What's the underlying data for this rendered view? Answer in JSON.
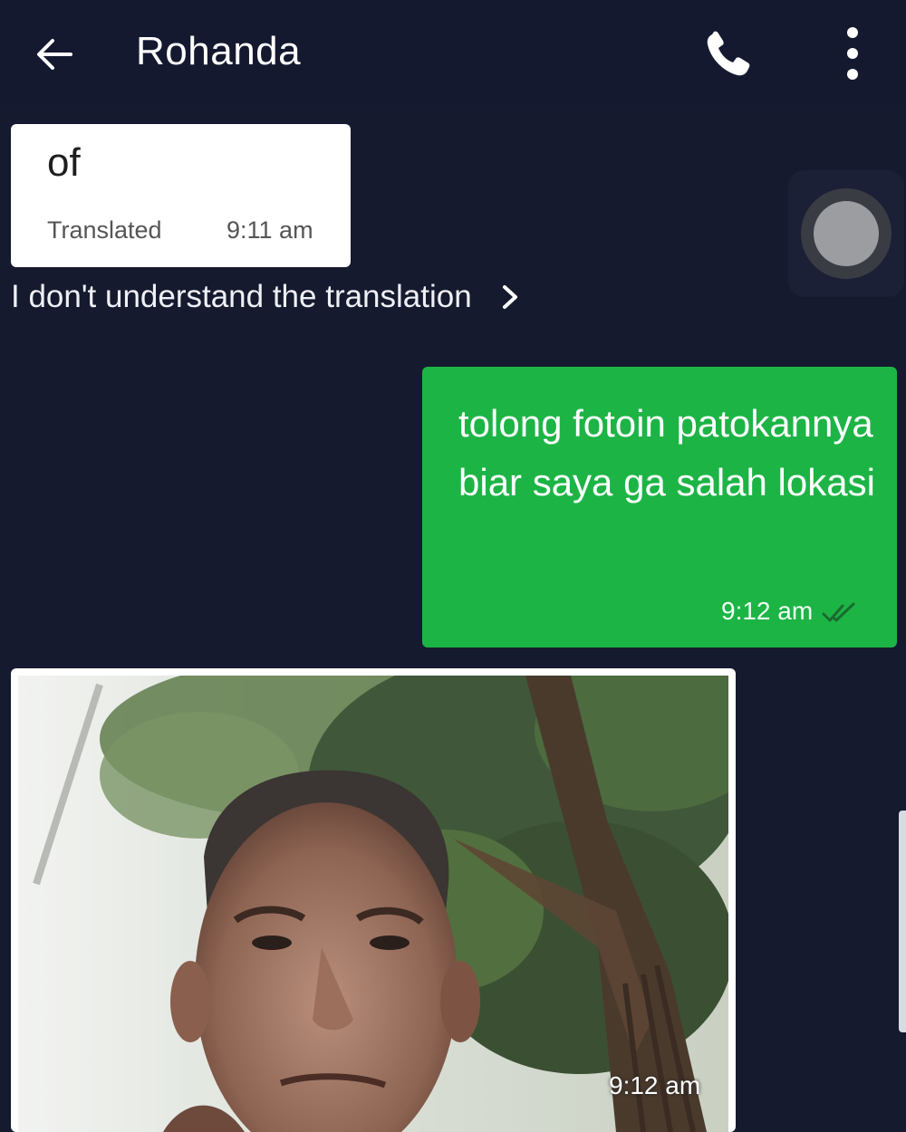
{
  "header": {
    "title": "Rohanda",
    "back_icon": "arrow-left-icon",
    "call_icon": "phone-icon",
    "more_icon": "more-vert-icon"
  },
  "messages": {
    "incoming_text": {
      "text": "of",
      "label": "Translated",
      "time": "9:11 am"
    },
    "translation_link": "I don't understand the translation",
    "outgoing_text": {
      "text": "tolong fotoin patokannya biar saya ga salah lokasi",
      "time": "9:12 am"
    },
    "incoming_photo": {
      "time": "9:12 am"
    }
  },
  "colors": {
    "background": "#151a2e",
    "outgoing_bubble": "#1db446",
    "incoming_bubble": "#ffffff"
  }
}
